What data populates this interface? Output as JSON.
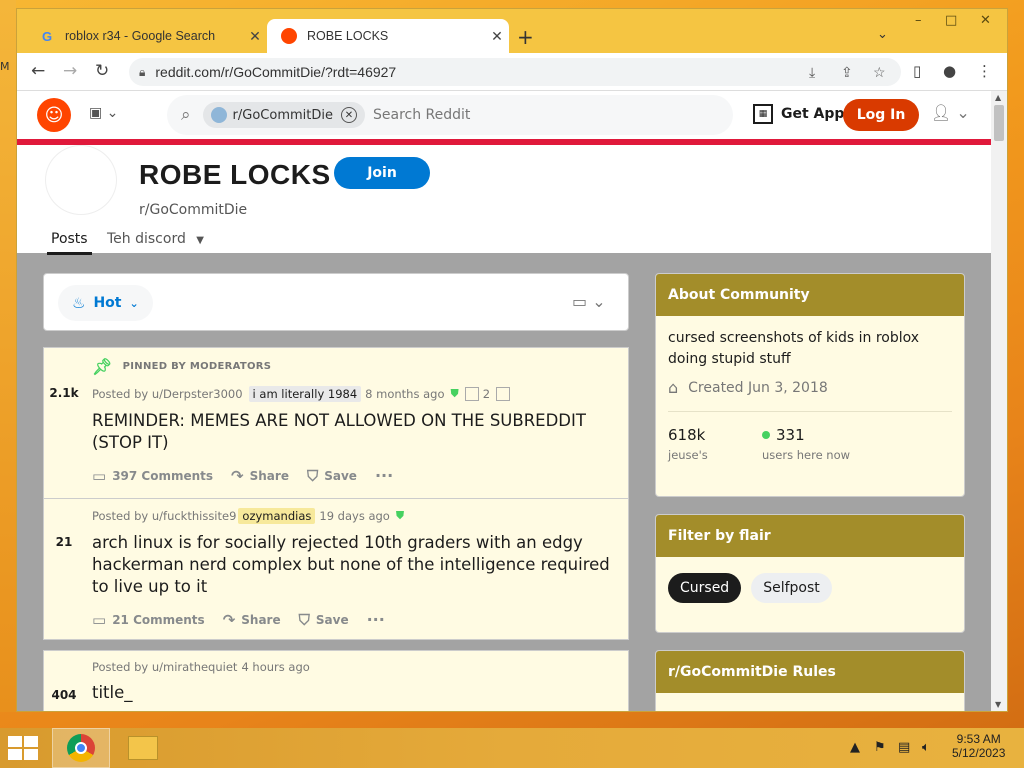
{
  "browser": {
    "tabs": [
      {
        "title": "roblox r34 - Google Search",
        "favicon": "G"
      },
      {
        "title": "ROBE LOCKS",
        "favicon": "reddit-icon"
      }
    ],
    "url": "reddit.com/r/GoCommitDie/?rdt=46927",
    "window_controls": [
      "–",
      "□",
      "✕"
    ]
  },
  "reddit_header": {
    "search_chip": "r/GoCommitDie",
    "search_placeholder": "Search Reddit",
    "get_app": "Get App",
    "login": "Log In"
  },
  "subreddit": {
    "title": "ROBE LOCKS",
    "join": "Join",
    "name": "r/GoCommitDie",
    "tabs": [
      "Posts",
      "Teh discord"
    ]
  },
  "sort": {
    "label": "Hot"
  },
  "posts": [
    {
      "votes": "2.1k",
      "pinned_label": "PINNED BY MODERATORS",
      "posted_by": "Posted by u/Derpster3000",
      "flair": "i am literally 1984",
      "time": "8 months ago",
      "awards": "2",
      "title": "REMINDER: MEMES ARE NOT ALLOWED ON THE SUBREDDIT (STOP IT)",
      "comments": "397 Comments",
      "share": "Share",
      "save": "Save"
    },
    {
      "votes": "21",
      "posted_by": "Posted by u/fuckthissite9",
      "flair": "ozymandias",
      "time": "19 days ago",
      "title": "arch linux is for socially rejected 10th graders with an edgy hackerman nerd complex but none of the intelligence required to live up to it",
      "comments": "21 Comments",
      "share": "Share",
      "save": "Save"
    },
    {
      "votes": "404",
      "posted_by": "Posted by u/mirathequiet",
      "time": "4 hours ago",
      "title": "title_"
    }
  ],
  "sidebar": {
    "about": {
      "header": "About Community",
      "description": "cursed screenshots of kids in roblox doing stupid stuff",
      "created": "Created Jun 3, 2018",
      "members": "618k",
      "members_label": "jeuse's",
      "online": "331",
      "online_label": "users here now"
    },
    "flair": {
      "header": "Filter by flair",
      "options": [
        "Cursed",
        "Selfpost"
      ]
    },
    "rules": {
      "header": "r/GoCommitDie Rules"
    }
  },
  "taskbar": {
    "time": "9:53 AM",
    "date": "5/12/2023"
  },
  "colors": {
    "reddit_orange": "#ff4500",
    "login_bg": "#d93a00",
    "join_blue": "#0079d3",
    "card_header": "#a38d2a",
    "post_bg": "#fffbe3",
    "red_bar": "#e0193b"
  }
}
